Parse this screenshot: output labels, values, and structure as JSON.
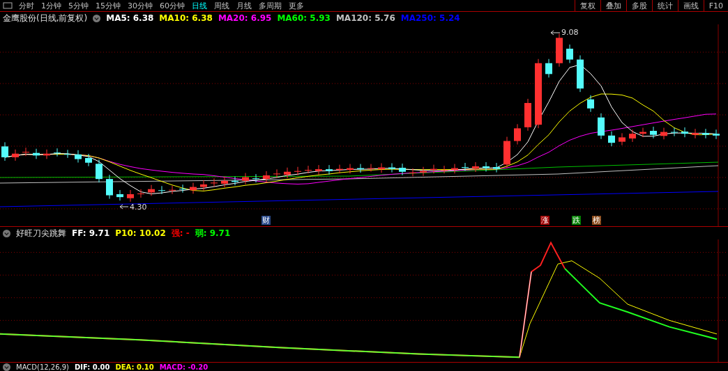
{
  "period_tabs": [
    {
      "label": "分时",
      "selected": false
    },
    {
      "label": "1分钟",
      "selected": false
    },
    {
      "label": "5分钟",
      "selected": false
    },
    {
      "label": "15分钟",
      "selected": false
    },
    {
      "label": "30分钟",
      "selected": false
    },
    {
      "label": "60分钟",
      "selected": false
    },
    {
      "label": "日线",
      "selected": true
    },
    {
      "label": "周线",
      "selected": false
    },
    {
      "label": "月线",
      "selected": false
    },
    {
      "label": "多周期",
      "selected": false
    },
    {
      "label": "更多",
      "selected": false
    }
  ],
  "toolbar_buttons": [
    "复权",
    "叠加",
    "多股",
    "统计",
    "画线",
    "F10"
  ],
  "main_chart": {
    "title": "金鹰股份(日线,前复权)",
    "readings": [
      {
        "label": "MA5: 6.38",
        "color": "#ffffff"
      },
      {
        "label": "MA10: 6.38",
        "color": "#ffff00"
      },
      {
        "label": "MA20: 6.95",
        "color": "#ff00ff"
      },
      {
        "label": "MA60: 5.93",
        "color": "#00ff00"
      },
      {
        "label": "MA120: 5.76",
        "color": "#c0c0c0"
      },
      {
        "label": "MA250: 5.24",
        "color": "#0000ff"
      }
    ],
    "high_label": "9.08",
    "low_label": "4.30",
    "event_markers": [
      {
        "label": "财",
        "color": "#2a4a8a"
      },
      {
        "label": "涨",
        "color": "#a00000"
      },
      {
        "label": "跌",
        "color": "#008000"
      },
      {
        "label": "榜",
        "color": "#8a4a1a"
      }
    ]
  },
  "indicator_panel": {
    "title": "好旺刀尖跳舞",
    "readings": [
      {
        "label": "FF: 9.71",
        "color": "#ffffff"
      },
      {
        "label": "P10: 10.02",
        "color": "#ffff00"
      },
      {
        "label": "强: -",
        "color": "#ff0000"
      },
      {
        "label": "弱: 9.71",
        "color": "#00ff00"
      }
    ]
  },
  "macd_panel": {
    "title": "MACD(12,26,9)",
    "readings": [
      {
        "label": "DIF: 0.00",
        "color": "#ffffff"
      },
      {
        "label": "DEA: 0.10",
        "color": "#ffff00"
      },
      {
        "label": "MACD: -0.20",
        "color": "#ff00ff"
      }
    ]
  }
}
